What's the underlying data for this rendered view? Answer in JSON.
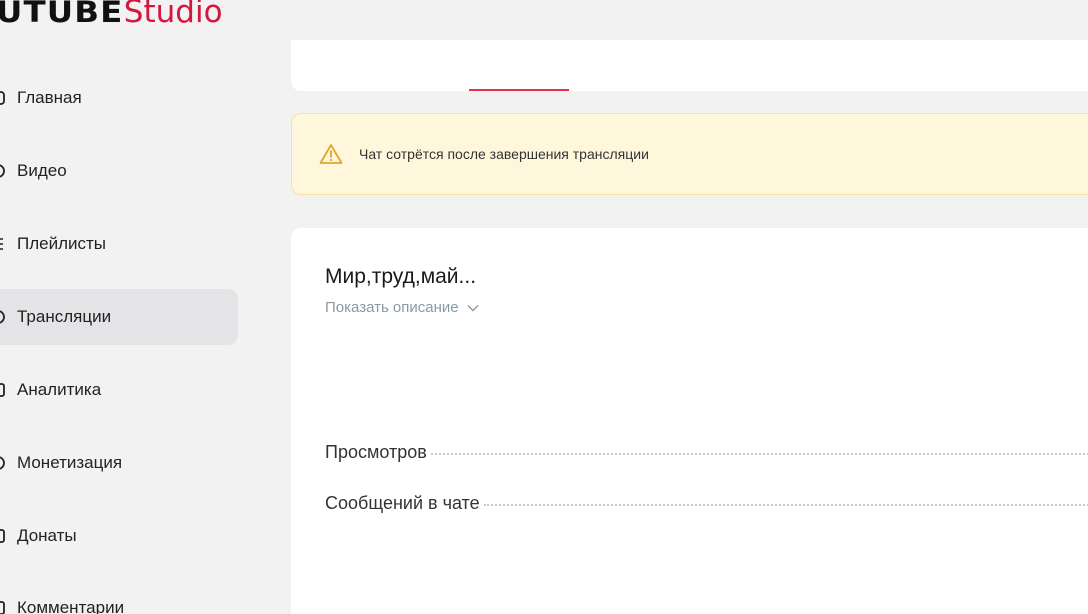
{
  "logo": {
    "main": "UTUBE",
    "studio": "Studio",
    "studio_color": "#d6173d"
  },
  "sidebar": {
    "items": [
      {
        "label": "Главная",
        "icon": "home-icon",
        "active": false
      },
      {
        "label": "Видео",
        "icon": "video-icon",
        "active": false
      },
      {
        "label": "Плейлисты",
        "icon": "playlist-icon",
        "active": false
      },
      {
        "label": "Трансляции",
        "icon": "broadcast-icon",
        "active": true
      },
      {
        "label": "Аналитика",
        "icon": "analytics-icon",
        "active": false
      },
      {
        "label": "Монетизация",
        "icon": "monetization-icon",
        "active": false
      },
      {
        "label": "Донаты",
        "icon": "donate-icon",
        "active": false
      },
      {
        "label": "Комментарии",
        "icon": "comments-icon",
        "active": false
      }
    ]
  },
  "alert": {
    "text": "Чат сотрётся после завершения трансляции",
    "icon": "warning-icon",
    "color": "#e2a431"
  },
  "stream": {
    "title": "Мир,труд,май...",
    "show_description": "Показать описание"
  },
  "stats": [
    {
      "label": "Просмотров"
    },
    {
      "label": "Сообщений в чате"
    }
  ],
  "colors": {
    "accent": "#e8304f",
    "active_bg": "#e4e4e7",
    "page_bg": "#f2f2f3"
  }
}
